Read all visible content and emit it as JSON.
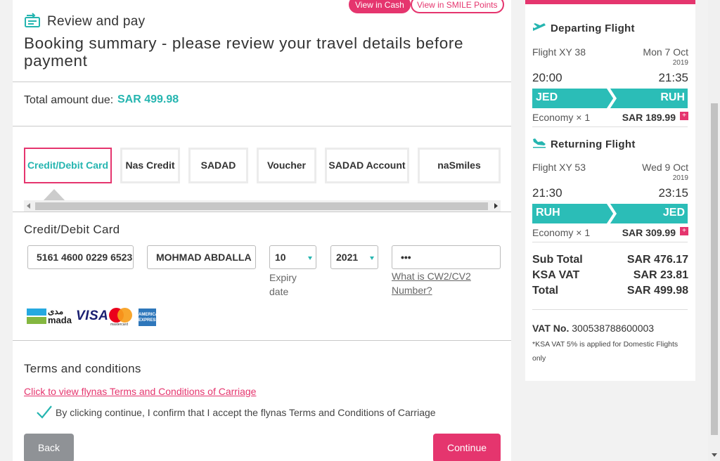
{
  "header": {
    "step_title": "Review and pay",
    "icon": "ticket-arrows-icon",
    "currency_toggle": {
      "cash_label": "View in Cash",
      "smile_label": "View in SMILE Points"
    },
    "page_title": "Booking summary - please review your travel details before payment"
  },
  "total": {
    "label": "Total amount due:",
    "value": "SAR 499.98"
  },
  "payment_tabs": [
    {
      "label": "Credit/Debit Card",
      "active": true
    },
    {
      "label": "Nas Credit"
    },
    {
      "label": "SADAD"
    },
    {
      "label": "Voucher"
    },
    {
      "label": "SADAD Account"
    },
    {
      "label": "naSmiles"
    }
  ],
  "card_form": {
    "title": "Credit/Debit Card",
    "card_number": "5161 4600 0229 6523",
    "card_holder": "MOHMAD ABDALLA",
    "expiry_month": "10",
    "expiry_year": "2021",
    "expiry_label": "Expiry date",
    "cvv": "•••",
    "cvv_help": "What is CW2/CV2 Number?",
    "card_brands": {
      "mada_arabic": "مدى",
      "mada": "mada",
      "visa": "VISA",
      "mastercard": "mastercard",
      "amex": "AMERICAN EXPRESS"
    }
  },
  "terms": {
    "title": "Terms and conditions",
    "link": "Click to view flynas Terms and Conditions of Carriage",
    "agree_text": "By clicking continue, I confirm that I accept the flynas Terms and Conditions of Carriage",
    "checked": true
  },
  "buttons": {
    "back": "Back",
    "continue": "Continue"
  },
  "summary": {
    "departing": {
      "title": "Departing Flight",
      "flight": "Flight XY 38",
      "date": "Mon 7 Oct",
      "year": "2019",
      "dep_time": "20:00",
      "arr_time": "21:35",
      "origin": "JED",
      "destination": "RUH",
      "cabin": "Economy × 1",
      "price": "SAR 189.99"
    },
    "returning": {
      "title": "Returning Flight",
      "flight": "Flight XY 53",
      "date": "Wed 9 Oct",
      "year": "2019",
      "dep_time": "21:30",
      "arr_time": "23:15",
      "origin": "RUH",
      "destination": "JED",
      "cabin": "Economy × 1",
      "price": "SAR 309.99"
    },
    "sub_total_label": "Sub Total",
    "sub_total": "SAR 476.17",
    "vat_label": "KSA VAT",
    "vat": "SAR 23.81",
    "total_label": "Total",
    "total": "SAR 499.98",
    "vat_no_label": "VAT No.",
    "vat_no": "300538788600003",
    "vat_note": "*KSA VAT 5% is applied for Domestic Flights only"
  },
  "colors": {
    "accent_pink": "#e5356e",
    "accent_teal": "#25b5b0",
    "route_teal": "#2bbdb7",
    "back_gray": "#8f9296"
  }
}
